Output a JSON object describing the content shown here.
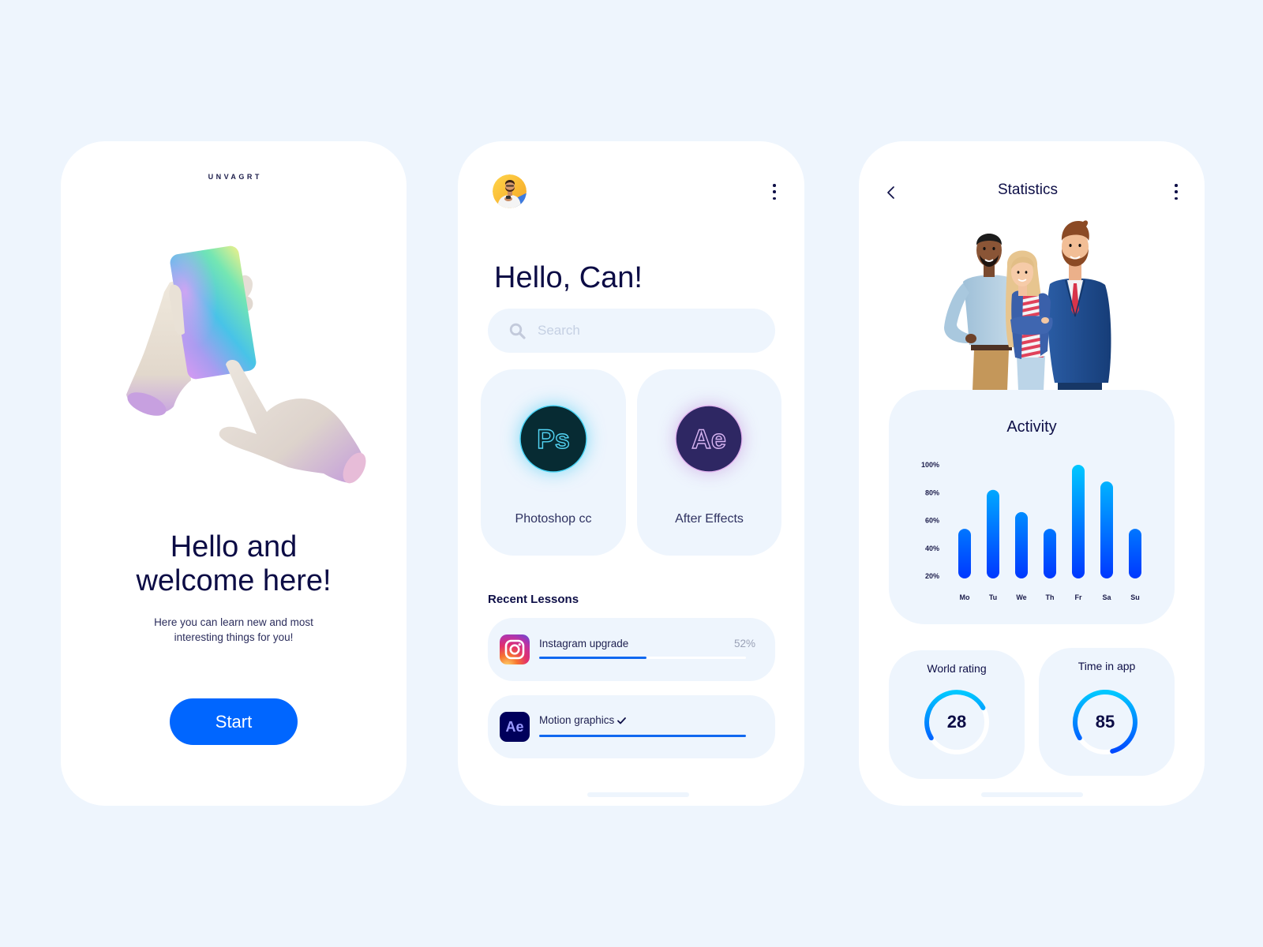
{
  "background_color": "#EEF5FD",
  "accent_color": "#0066FF",
  "text_color": "#0E0F47",
  "welcome_screen": {
    "brand": "UNVAGRT",
    "illustration": "hands-holding-phone",
    "headline_line1": "Hello and",
    "headline_line2": "welcome here!",
    "subtitle_line1": "Here you can learn new and most",
    "subtitle_line2": "interesting things for you!",
    "start_button": "Start"
  },
  "home_screen": {
    "avatar_icon": "user-avatar",
    "menu_icon": "kebab-menu-icon",
    "greeting": "Hello, Can!",
    "search": {
      "placeholder": "Search",
      "value": "",
      "icon": "search-icon"
    },
    "courses": [
      {
        "label": "Photoshop cc",
        "icon": "photoshop-icon",
        "icon_text": "Ps",
        "color": "#31C5F0"
      },
      {
        "label": "After Effects",
        "icon": "after-effects-icon",
        "icon_text": "Ae",
        "color": "#D9A6EA"
      }
    ],
    "recent_lessons_title": "Recent Lessons",
    "lessons": [
      {
        "title": "Instagram upgrade",
        "icon": "instagram-icon",
        "progress_label": "52%",
        "progress": 52,
        "completed": false
      },
      {
        "title": "Motion graphics",
        "icon": "after-effects-icon",
        "icon_text": "Ae",
        "progress": 100,
        "completed": true,
        "status_icon": "checkmark-icon"
      }
    ]
  },
  "stats_screen": {
    "title": "Statistics",
    "back_icon": "chevron-left-icon",
    "menu_icon": "kebab-menu-icon",
    "illustration": "three-people",
    "world_rating": {
      "label": "World rating",
      "value": "28",
      "fill": 0.51
    },
    "time_in_app": {
      "label": "Time in app",
      "value": "85",
      "fill": 0.8
    },
    "gauge_gradient": [
      "#00C8FF",
      "#0048FF"
    ]
  },
  "chart_data": {
    "type": "bar",
    "title": "Activity",
    "categories": [
      "Mo",
      "Tu",
      "We",
      "Th",
      "Fr",
      "Sa",
      "Su"
    ],
    "values": [
      54,
      82,
      66,
      54,
      100,
      88,
      54
    ],
    "yticks": [
      "20%",
      "40%",
      "60%",
      "80%",
      "100%"
    ],
    "ytick_values": [
      20,
      40,
      60,
      80,
      100
    ],
    "ylim": [
      20,
      100
    ],
    "xlabel": "",
    "ylabel": "",
    "unit": "%",
    "grid": false,
    "legend": "none",
    "bar_gradient": [
      "#00C8FF",
      "#0038FF"
    ]
  }
}
